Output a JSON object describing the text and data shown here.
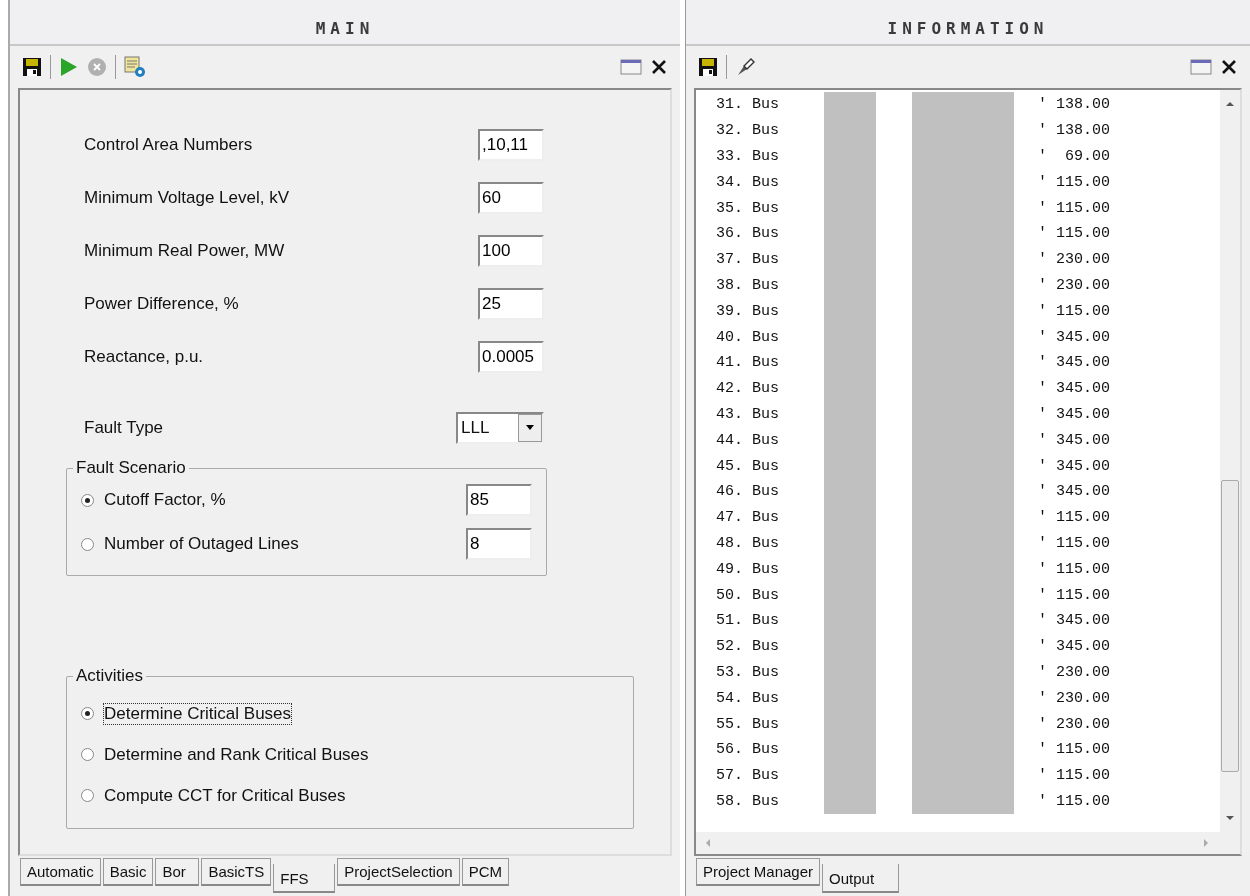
{
  "main": {
    "title": "MAIN",
    "fields": [
      {
        "label": "Control Area Numbers",
        "value": ",10,11"
      },
      {
        "label": "Minimum Voltage Level, kV",
        "value": "60"
      },
      {
        "label": "Minimum Real Power, MW",
        "value": "100"
      },
      {
        "label": "Power Difference, %",
        "value": "25"
      },
      {
        "label": "Reactance, p.u.",
        "value": "0.0005"
      }
    ],
    "fault_type": {
      "label": "Fault Type",
      "value": "LLL"
    },
    "fault_scenario": {
      "title": "Fault Scenario",
      "options": [
        {
          "label": "Cutoff Factor, %",
          "selected": true,
          "value": "85"
        },
        {
          "label": "Number of Outaged Lines",
          "selected": false,
          "value": "8"
        }
      ]
    },
    "activities": {
      "title": "Activities",
      "options": [
        {
          "label": "Determine Critical Buses",
          "selected": true
        },
        {
          "label": "Determine and Rank Critical Buses",
          "selected": false
        },
        {
          "label": "Compute CCT for Critical Buses",
          "selected": false
        }
      ]
    },
    "tabs": [
      {
        "label": "Automatic",
        "selected": false
      },
      {
        "label": "Basic",
        "selected": false
      },
      {
        "label": "Bor",
        "selected": false
      },
      {
        "label": "BasicTS",
        "selected": false
      },
      {
        "label": "FFS",
        "selected": true
      },
      {
        "label": "ProjectSelection",
        "selected": false
      },
      {
        "label": "PCM",
        "selected": false
      }
    ]
  },
  "information": {
    "title": "INFORMATION",
    "lines": [
      {
        "index": "31.",
        "word": "Bus",
        "value": "' 138.00"
      },
      {
        "index": "32.",
        "word": "Bus",
        "value": "' 138.00"
      },
      {
        "index": "33.",
        "word": "Bus",
        "value": "'  69.00"
      },
      {
        "index": "34.",
        "word": "Bus",
        "value": "' 115.00"
      },
      {
        "index": "35.",
        "word": "Bus",
        "value": "' 115.00"
      },
      {
        "index": "36.",
        "word": "Bus",
        "value": "' 115.00"
      },
      {
        "index": "37.",
        "word": "Bus",
        "value": "' 230.00"
      },
      {
        "index": "38.",
        "word": "Bus",
        "value": "' 230.00"
      },
      {
        "index": "39.",
        "word": "Bus",
        "value": "' 115.00"
      },
      {
        "index": "40.",
        "word": "Bus",
        "value": "' 345.00"
      },
      {
        "index": "41.",
        "word": "Bus",
        "value": "' 345.00"
      },
      {
        "index": "42.",
        "word": "Bus",
        "value": "' 345.00"
      },
      {
        "index": "43.",
        "word": "Bus",
        "value": "' 345.00"
      },
      {
        "index": "44.",
        "word": "Bus",
        "value": "' 345.00"
      },
      {
        "index": "45.",
        "word": "Bus",
        "value": "' 345.00"
      },
      {
        "index": "46.",
        "word": "Bus",
        "value": "' 345.00"
      },
      {
        "index": "47.",
        "word": "Bus",
        "value": "' 115.00"
      },
      {
        "index": "48.",
        "word": "Bus",
        "value": "' 115.00"
      },
      {
        "index": "49.",
        "word": "Bus",
        "value": "' 115.00"
      },
      {
        "index": "50.",
        "word": "Bus",
        "value": "' 115.00"
      },
      {
        "index": "51.",
        "word": "Bus",
        "value": "' 345.00"
      },
      {
        "index": "52.",
        "word": "Bus",
        "value": "' 345.00"
      },
      {
        "index": "53.",
        "word": "Bus",
        "value": "' 230.00"
      },
      {
        "index": "54.",
        "word": "Bus",
        "value": "' 230.00"
      },
      {
        "index": "55.",
        "word": "Bus",
        "value": "' 230.00"
      },
      {
        "index": "56.",
        "word": "Bus",
        "value": "' 115.00"
      },
      {
        "index": "57.",
        "word": "Bus",
        "value": "' 115.00"
      },
      {
        "index": "58.",
        "word": "Bus",
        "value": "' 115.00"
      }
    ],
    "tabs": [
      {
        "label": "Project Manager",
        "selected": false
      },
      {
        "label": "Output",
        "selected": true
      }
    ]
  }
}
